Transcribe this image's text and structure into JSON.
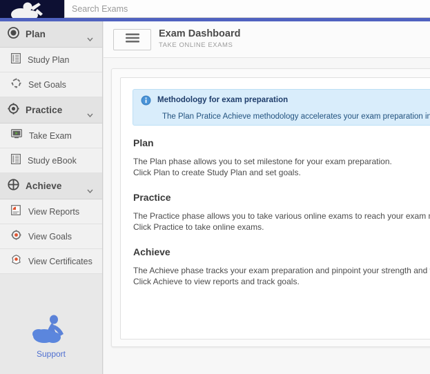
{
  "navbar": {
    "logo_icon": "cloud-person-logo",
    "search": {
      "placeholder": "Search Exams",
      "value": ""
    }
  },
  "sidebar": {
    "groups": [
      {
        "label": "Plan",
        "icon": "circle-dot-icon",
        "chevron": "chevron-down-icon",
        "items": [
          {
            "label": "Study Plan",
            "icon": "document-lines-icon"
          },
          {
            "label": "Set Goals",
            "icon": "target-dashed-icon"
          }
        ]
      },
      {
        "label": "Practice",
        "icon": "crosshair-icon",
        "chevron": "chevron-down-icon",
        "items": [
          {
            "label": "Take Exam",
            "icon": "monitor-play-icon"
          },
          {
            "label": "Study eBook",
            "icon": "book-lines-icon"
          }
        ]
      },
      {
        "label": "Achieve",
        "icon": "circle-cross-icon",
        "chevron": "chevron-down-icon",
        "items": [
          {
            "label": "View Reports",
            "icon": "report-chart-icon"
          },
          {
            "label": "View Goals",
            "icon": "target-bullseye-icon"
          },
          {
            "label": "View Certificates",
            "icon": "certificate-badge-icon"
          }
        ]
      }
    ],
    "support": {
      "label": "Support",
      "icon": "support-cloud-person-icon"
    }
  },
  "header": {
    "menu_icon": "hamburger-menu-icon",
    "title": "Exam Dashboard",
    "subtitle": "TAKE ONLINE EXAMS"
  },
  "alert": {
    "icon": "info-circle-icon",
    "title": "Methodology for exam preparation",
    "text": "The Plan Pratice Achieve methodology accelerates your exam preparation in right m"
  },
  "sections": [
    {
      "heading": "Plan",
      "line1": "The Plan phase allows you to set milestone for your exam preparation.",
      "line2": "Click Plan to create Study Plan and set goals."
    },
    {
      "heading": "Practice",
      "line1": "The Practice phase allows you to take various online exams to reach your exam milestone",
      "line2": "Click Practice to take online exams."
    },
    {
      "heading": "Achieve",
      "line1": "The Achieve phase tracks your exam preparation and pinpoint your strength and weakne",
      "line2": "Click Achieve to view reports and track goals."
    }
  ],
  "colors": {
    "navbar_bg": "#0d1033",
    "navbar_strip": "#4f62c0",
    "accent_link": "#4f6fd0",
    "alert_bg": "#d9edfb",
    "icon_orange": "#e0532f"
  }
}
